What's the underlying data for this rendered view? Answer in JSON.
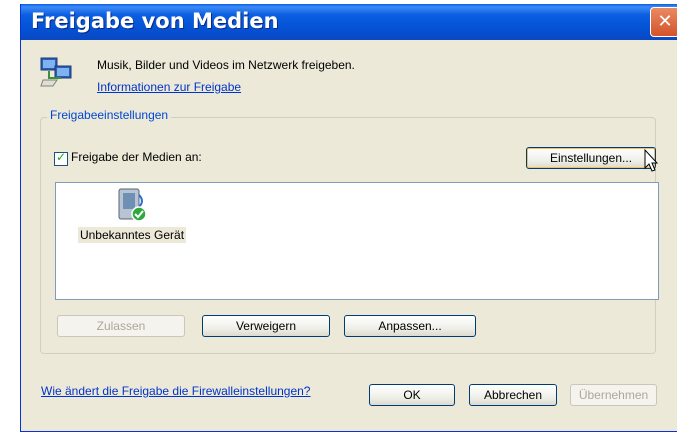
{
  "window": {
    "title": "Freigabe von Medien",
    "close_label": "✕"
  },
  "intro": {
    "text": "Musik, Bilder und Videos im Netzwerk freigeben.",
    "link": "Informationen zur Freigabe"
  },
  "settings_group": {
    "label": "Freigabeeinstellungen",
    "share_checkbox_label": "Freigabe der Medien an:",
    "share_checked": true,
    "settings_button": "Einstellungen..."
  },
  "device_list": {
    "items": [
      {
        "label": "Unbekanntes Gerät",
        "icon": "media-device-icon"
      }
    ]
  },
  "action_buttons": {
    "allow": "Zulassen",
    "deny": "Verweigern",
    "customize": "Anpassen..."
  },
  "footer": {
    "firewall_link": "Wie ändert die Freigabe die Firewalleinstellungen?",
    "ok": "OK",
    "cancel": "Abbrechen",
    "apply": "Übernehmen"
  },
  "colors": {
    "titlebar": "#0451d4",
    "dialog_background": "#ece9d8",
    "link": "#0033cc",
    "group_label": "#0046d5"
  }
}
